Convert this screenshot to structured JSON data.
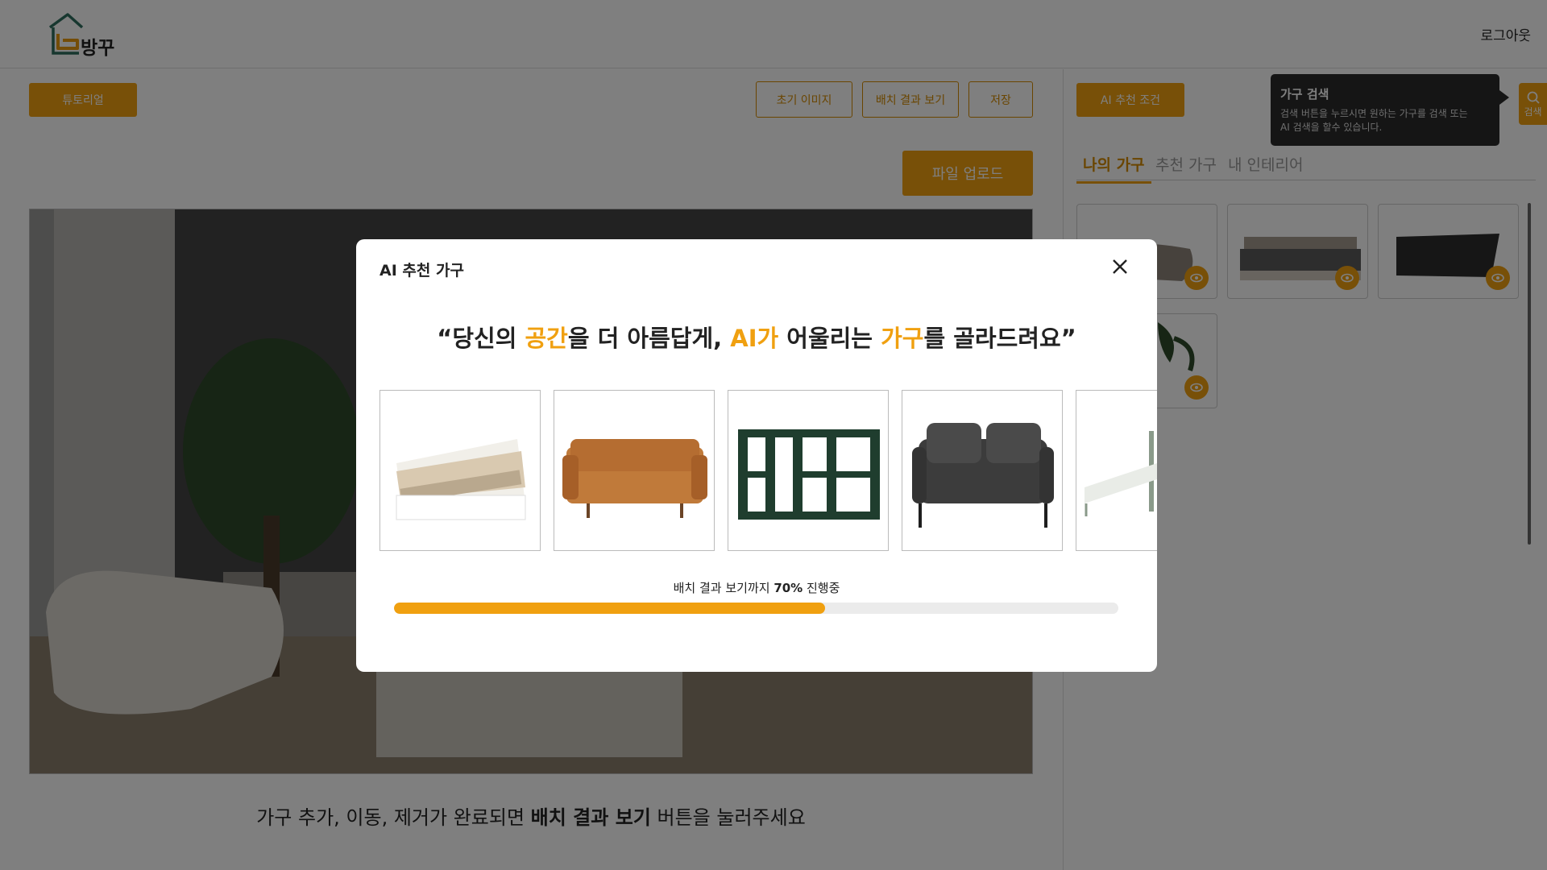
{
  "app": {
    "brand": "방꾸",
    "logout_label": "로그아웃"
  },
  "toolbar": {
    "tutorial_label": "튜토리얼",
    "reset_label": "초기 이미지",
    "result_label": "배치 결과 보기",
    "save_label": "저장",
    "upload_label": "파일 업로드"
  },
  "canvas": {
    "hint_pre": "가구 추가, 이동, 제거가 완료되면 ",
    "hint_bold": "배치 결과 보기",
    "hint_post": " 버튼을 눌러주세요"
  },
  "right_panel": {
    "ai_condition_label": "AI 추천 조건",
    "tabs": [
      {
        "label": "나의 가구",
        "active": true
      },
      {
        "label": "추천 가구",
        "active": false
      },
      {
        "label": "내 인테리어",
        "active": false
      }
    ],
    "cards": [
      {
        "icon": "lounge-chair-icon"
      },
      {
        "icon": "bed-icon"
      },
      {
        "icon": "ottoman-icon"
      },
      {
        "icon": "plant-icon"
      }
    ]
  },
  "tooltip": {
    "title": "가구 검색",
    "body_line1": "검색 버튼을 누르시면 원하는 가구를 검색 또는",
    "body_line2": "AI 검색을 할수 있습니다."
  },
  "search_side": {
    "label": "검색"
  },
  "modal": {
    "title": "AI 추천 가구",
    "headline_parts": {
      "p1": "“당신의 ",
      "h1": "공간",
      "p2": "을 더 아름답게, ",
      "h2": "AI가",
      "p3": " 어울리는 ",
      "h3": "가구",
      "p4": "를 골라드려요”"
    },
    "products": [
      {
        "icon": "bed-icon"
      },
      {
        "icon": "sofa-icon"
      },
      {
        "icon": "shelf-icon"
      },
      {
        "icon": "loveseat-icon"
      },
      {
        "icon": "bed-frame-icon"
      }
    ],
    "progress": {
      "label_pre": "배치 결과 보기까지 ",
      "label_value": "70%",
      "label_post": " 진행중",
      "value": 0.595
    }
  },
  "colors": {
    "accent": "#f0a010",
    "accent_dark": "#d48a00"
  }
}
